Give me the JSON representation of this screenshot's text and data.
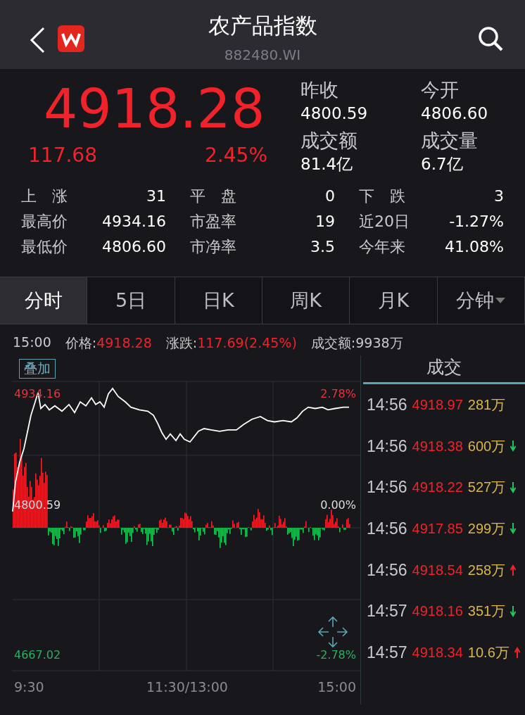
{
  "header": {
    "title": "农产品指数",
    "code": "882480.WI"
  },
  "quote": {
    "price": "4918.28",
    "change": "117.68",
    "change_pct": "2.45%",
    "side": [
      {
        "label": "昨收",
        "value": "4800.59"
      },
      {
        "label": "今开",
        "value": "4806.60"
      },
      {
        "label": "成交额",
        "value": "81.4亿"
      },
      {
        "label": "成交量",
        "value": "6.7亿"
      }
    ]
  },
  "stats": [
    [
      {
        "label": "上　涨",
        "value": "31"
      },
      {
        "label": "平　盘",
        "value": "0"
      },
      {
        "label": "下　跌",
        "value": "3"
      }
    ],
    [
      {
        "label": "最高价",
        "value": "4934.16"
      },
      {
        "label": "市盈率",
        "value": "19"
      },
      {
        "label": "近20日",
        "value": "-1.27%"
      }
    ],
    [
      {
        "label": "最低价",
        "value": "4806.60"
      },
      {
        "label": "市净率",
        "value": "3.5"
      },
      {
        "label": "今年来",
        "value": "41.08%"
      }
    ]
  ],
  "tabs": [
    {
      "label": "分时",
      "selected": true,
      "dropdown": false
    },
    {
      "label": "5日",
      "selected": false,
      "dropdown": false
    },
    {
      "label": "日K",
      "selected": false,
      "dropdown": false
    },
    {
      "label": "周K",
      "selected": false,
      "dropdown": false
    },
    {
      "label": "月K",
      "selected": false,
      "dropdown": false
    },
    {
      "label": "分钟",
      "selected": false,
      "dropdown": true
    }
  ],
  "info": {
    "time": "15:00",
    "price_label": "价格:",
    "price": "4918.28",
    "change_label": "涨跌:",
    "change": "117.69(2.45%)",
    "amount_label": "成交额:",
    "amount": "9938万"
  },
  "chart": {
    "overlay_button": "叠加",
    "high": "4934.16",
    "high_pct": "2.78%",
    "base": "4800.59",
    "base_pct": "0.00%",
    "low": "4667.02",
    "low_pct": "-2.78%",
    "x_labels": [
      "9:30",
      "11:30/13:00",
      "15:00"
    ]
  },
  "trades": {
    "title": "成交",
    "rows": [
      {
        "time": "14:56",
        "price": "4918.97",
        "volume": "281万",
        "kind": "plain"
      },
      {
        "time": "14:56",
        "price": "4918.38",
        "volume": "600万",
        "kind": "down"
      },
      {
        "time": "14:56",
        "price": "4918.22",
        "volume": "527万",
        "kind": "down"
      },
      {
        "time": "14:56",
        "price": "4917.85",
        "volume": "299万",
        "kind": "down"
      },
      {
        "time": "14:56",
        "price": "4918.54",
        "volume": "258万",
        "kind": "up"
      },
      {
        "time": "14:57",
        "price": "4918.16",
        "volume": "351万",
        "kind": "down"
      },
      {
        "time": "14:57",
        "price": "4918.34",
        "volume": "10.6万",
        "kind": "up"
      }
    ]
  }
}
